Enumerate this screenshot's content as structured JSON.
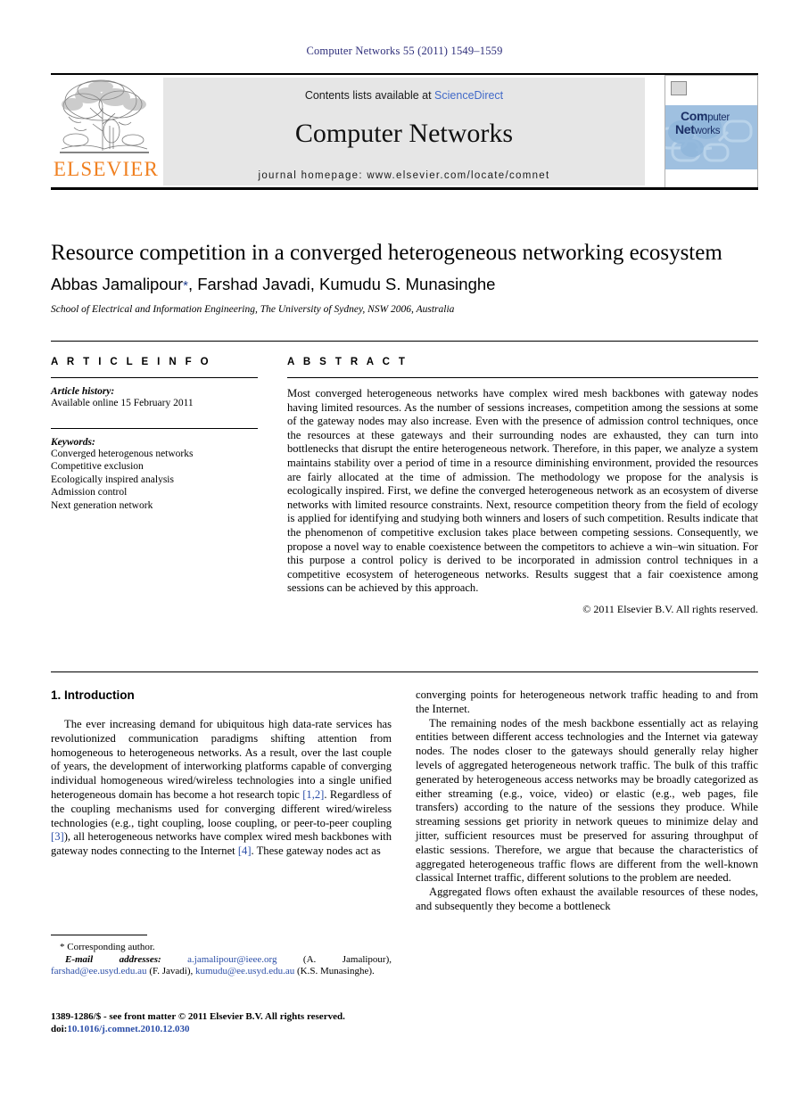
{
  "running_head": "Computer Networks 55 (2011) 1549–1559",
  "masthead": {
    "contents_prefix": "Contents lists available at ",
    "sciencedirect": "ScienceDirect",
    "journal_title": "Computer Networks",
    "homepage": "journal homepage: www.elsevier.com/locate/comnet",
    "publisher_wordmark": "ELSEVIER",
    "cover": {
      "title_line1_bold": "Com",
      "title_line1_rest": "puter",
      "title_line2_bold": "Net",
      "title_line2_rest": "works"
    },
    "accent_link_color": "#4169c8",
    "publisher_color": "#f08020"
  },
  "article": {
    "title": "Resource competition in a converged heterogeneous networking ecosystem",
    "authors": "Abbas Jamalipour",
    "authors_rest": ", Farshad Javadi, Kumudu S. Munasinghe",
    "corresponding_marker": "*",
    "affiliation": "School of Electrical and Information Engineering, The University of Sydney, NSW 2006, Australia"
  },
  "info": {
    "heading": "A R T I C L E    I N F O",
    "history_label": "Article history:",
    "history_value": "Available online 15 February 2011",
    "keywords_label": "Keywords:",
    "keywords": [
      "Converged heterogenous networks",
      "Competitive exclusion",
      "Ecologically inspired analysis",
      "Admission control",
      "Next generation network"
    ]
  },
  "abstract": {
    "heading": "A B S T R A C T",
    "text": "Most converged heterogeneous networks have complex wired mesh backbones with gateway nodes having limited resources. As the number of sessions increases, competition among the sessions at some of the gateway nodes may also increase. Even with the presence of admission control techniques, once the resources at these gateways and their surrounding nodes are exhausted, they can turn into bottlenecks that disrupt the entire heterogeneous network. Therefore, in this paper, we analyze a system maintains stability over a period of time in a resource diminishing environment, provided the resources are fairly allocated at the time of admission. The methodology we propose for the analysis is ecologically inspired. First, we define the converged heterogeneous network as an ecosystem of diverse networks with limited resource constraints. Next, resource competition theory from the field of ecology is applied for identifying and studying both winners and losers of such competition. Results indicate that the phenomenon of competitive exclusion takes place between competing sessions. Consequently, we propose a novel way to enable coexistence between the competitors to achieve a win–win situation. For this purpose a control policy is derived to be incorporated in admission control techniques in a competitive ecosystem of heterogeneous networks. Results suggest that a fair coexistence among sessions can be achieved by this approach.",
    "copyright": "© 2011 Elsevier B.V. All rights reserved."
  },
  "body": {
    "section_title": "1. Introduction",
    "left_p1_a": "The ever increasing demand for ubiquitous high data-rate services has revolutionized communication paradigms shifting attention from homogeneous to heterogeneous networks. As a result, over the last couple of years, the development of interworking platforms capable of converging individual homogeneous wired/wireless technologies into a single unified heterogeneous domain has become a hot research topic ",
    "left_cite_1": "[1,2]",
    "left_p1_b": ". Regardless of the coupling mechanisms used for converging different wired/wireless technologies (e.g., tight coupling, loose coupling, or peer-to-peer coupling ",
    "left_cite_2": "[3]",
    "left_p1_c": "), all heterogeneous networks have complex wired mesh backbones with gateway nodes connecting to the Internet ",
    "left_cite_3": "[4]",
    "left_p1_d": ". These gateway nodes act as",
    "right_p1": "converging points for heterogeneous network traffic heading to and from the Internet.",
    "right_p2": "The remaining nodes of the mesh backbone essentially act as relaying entities between different access technologies and the Internet via gateway nodes. The nodes closer to the gateways should generally relay higher levels of aggregated heterogeneous network traffic. The bulk of this traffic generated by heterogeneous access networks may be broadly categorized as either streaming (e.g., voice, video) or elastic (e.g., web pages, file transfers) according to the nature of the sessions they produce. While streaming sessions get priority in network queues to minimize delay and jitter, sufficient resources must be preserved for assuring throughput of elastic sessions. Therefore, we argue that because the characteristics of aggregated heterogeneous traffic flows are different from the well-known classical Internet traffic, different solutions to the problem are needed.",
    "right_p3": "Aggregated flows often exhaust the available resources of these nodes, and subsequently they become a bottleneck"
  },
  "footnote": {
    "corresponding_marker": "*",
    "corresponding_text": "Corresponding author.",
    "email_label": "E-mail addresses:",
    "email1": "a.jamalipour@ieee.org",
    "email1_owner": "(A. Jamalipour),",
    "email2": "farshad@ee.usyd.edu.au",
    "email2_owner": "(F. Javadi),",
    "email3": "kumudu@ee.usyd.edu.au",
    "email3_owner": "(K.S. Munasinghe)."
  },
  "imprint": {
    "issn_line": "1389-1286/$ - see front matter © 2011 Elsevier B.V. All rights reserved.",
    "doi_label": "doi:",
    "doi_value": "10.1016/j.comnet.2010.12.030"
  }
}
